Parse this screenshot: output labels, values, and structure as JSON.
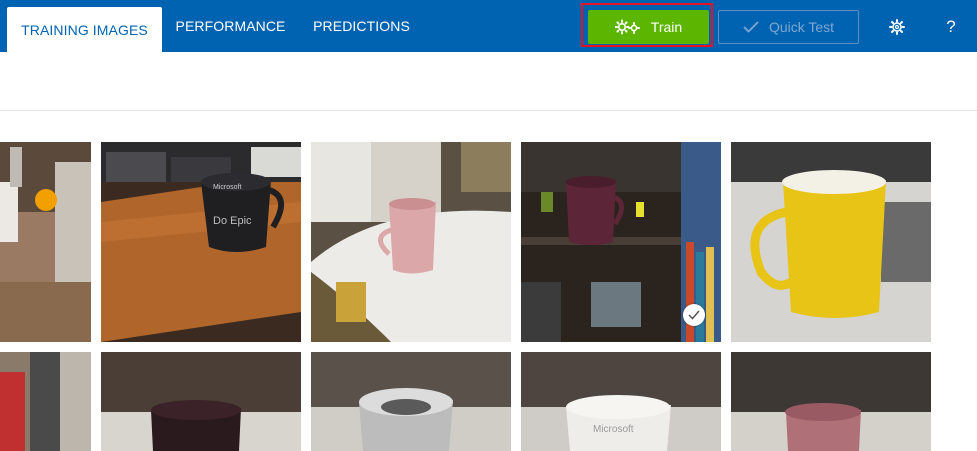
{
  "tabs": [
    {
      "label": "TRAINING IMAGES",
      "active": true
    },
    {
      "label": "PERFORMANCE",
      "active": false
    },
    {
      "label": "PREDICTIONS",
      "active": false
    }
  ],
  "toolbar": {
    "train_label": "Train",
    "quick_test_label": "Quick Test",
    "help_label": "?"
  },
  "colors": {
    "header_bg": "#0063b1",
    "train_bg": "#5cb500",
    "highlight": "#e81123"
  },
  "images": {
    "selected_index": 3
  }
}
